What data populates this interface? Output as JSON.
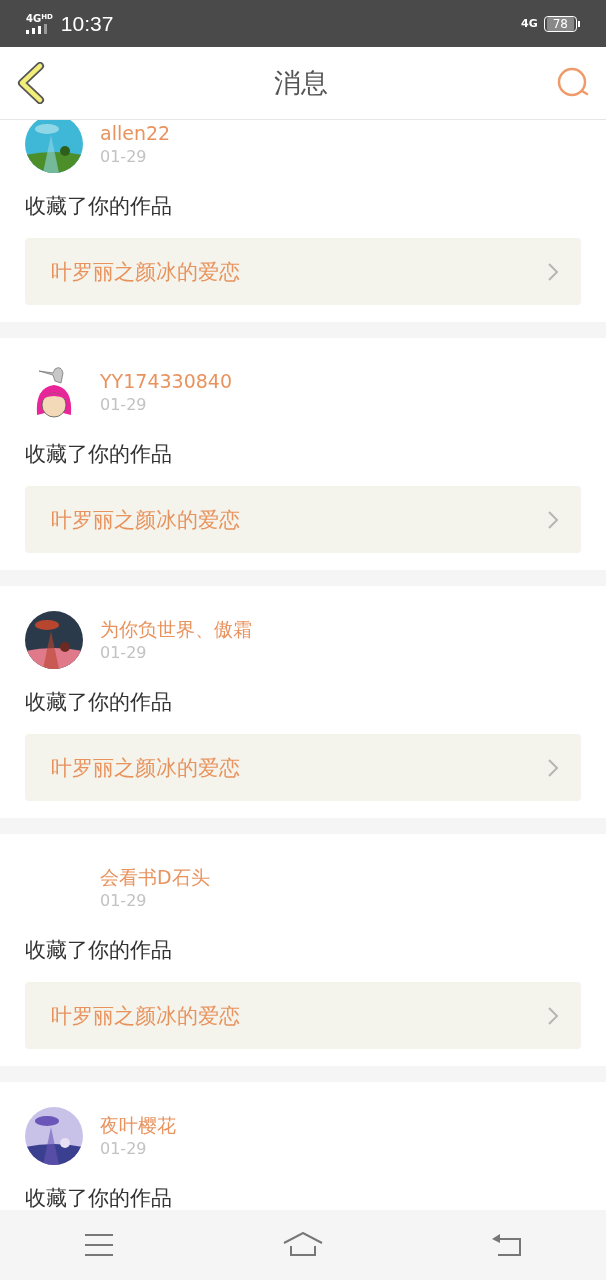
{
  "status_bar": {
    "network": "4G",
    "network_sup": "HD",
    "time": "10:37",
    "network_right": "4G",
    "battery": "78"
  },
  "header": {
    "title": "消息"
  },
  "messages": [
    {
      "kind": "picture",
      "name": "allen22",
      "date": "01-29",
      "action": "收藏了你的作品",
      "work": "叶罗丽之颜冰的爱恋"
    },
    {
      "kind": "figure",
      "name": "YY174330840",
      "date": "01-29",
      "action": "收藏了你的作品",
      "work": "叶罗丽之颜冰的爱恋"
    },
    {
      "kind": "picture",
      "name": "为你负世界、傲霜",
      "date": "01-29",
      "action": "收藏了你的作品",
      "work": "叶罗丽之颜冰的爱恋"
    },
    {
      "name": "会看书D石头",
      "date": "01-29",
      "action": "收藏了你的作品",
      "work": "叶罗丽之颜冰的爱恋"
    },
    {
      "kind": "picture",
      "name": "夜叶樱花",
      "date": "01-29",
      "action": "收藏了你的作品"
    }
  ]
}
